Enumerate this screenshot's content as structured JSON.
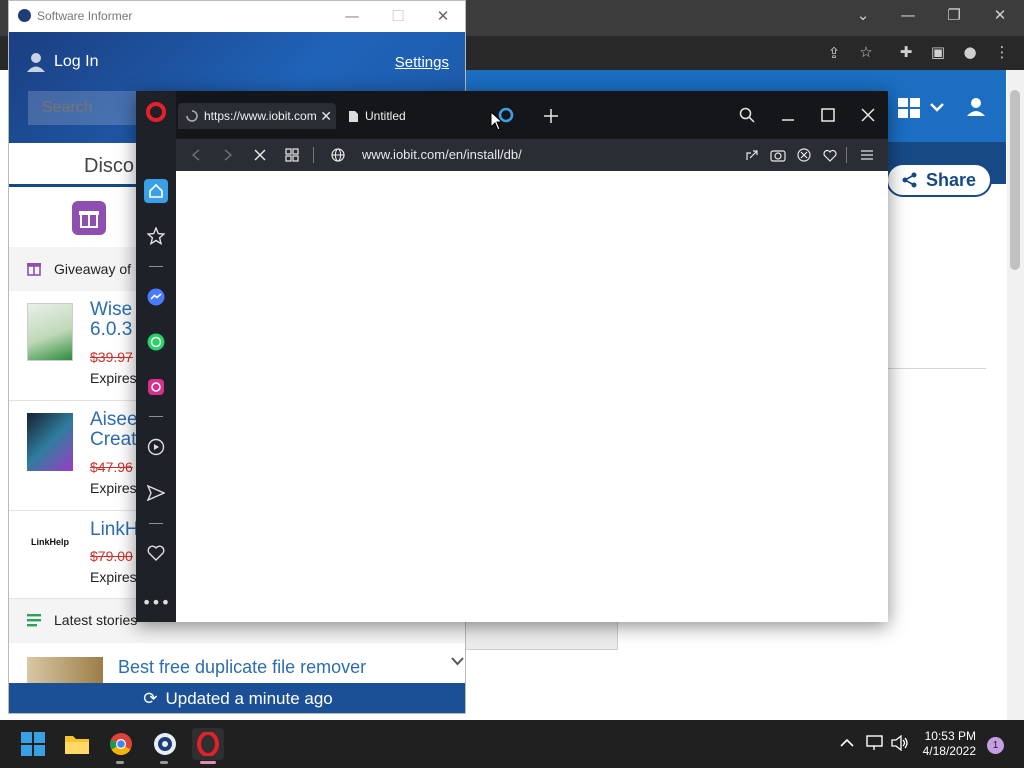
{
  "software_informer": {
    "window_title": "Software Informer",
    "login_label": "Log In",
    "settings_label": "Settings",
    "search_placeholder": "Search",
    "discover_tab": "Disco",
    "giveaway_heading": "Giveaway of",
    "items": [
      {
        "name_line1": "Wise",
        "name_line2": "6.0.3",
        "price": "$39.97",
        "expires": "Expires"
      },
      {
        "name_line1": "Aisee",
        "name_line2": "Creat",
        "price": "$47.96",
        "expires": "Expires"
      },
      {
        "name_line1": "LinkH",
        "name_line2": "",
        "price": "$79.00",
        "expires": "Expires",
        "logo_text": "LinkHelp"
      }
    ],
    "latest_heading": "Latest stories",
    "story_title": "Best free duplicate file remover",
    "footer": "Updated a minute ago"
  },
  "chrome": {
    "share_label": "Share"
  },
  "opera": {
    "tabs": [
      {
        "title": "https://www.iobit.com"
      },
      {
        "title": "Untitled"
      }
    ],
    "address": "www.iobit.com/en/install/db/"
  },
  "taskbar": {
    "time": "10:53 PM",
    "date": "4/18/2022",
    "notification_count": "1"
  },
  "colors": {
    "opera_red": "#e3202b",
    "si_blue": "#1b4f96",
    "link_blue": "#2c6db2",
    "price_red": "#d0302a",
    "taskbar": "#202020"
  }
}
